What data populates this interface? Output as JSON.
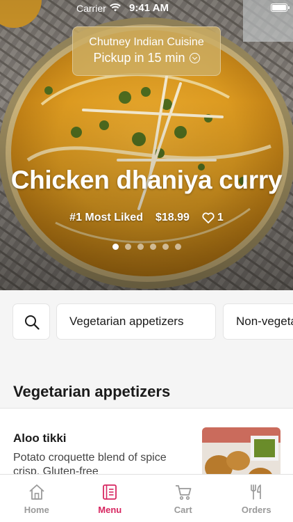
{
  "status_bar": {
    "carrier": "Carrier",
    "time": "9:41 AM"
  },
  "restaurant": {
    "name": "Chutney Indian Cuisine",
    "pickup": "Pickup in 15 min"
  },
  "featured": {
    "title": "Chicken dhaniya curry",
    "badge": "#1 Most Liked",
    "price": "$18.99",
    "likes": "1",
    "carousel_total": 6,
    "carousel_active": 1
  },
  "categories": [
    "Vegetarian appetizers",
    "Non-vegetarian appetizers"
  ],
  "section": {
    "title": "Vegetarian appetizers",
    "items": [
      {
        "name": "Aloo tikki",
        "description": "Potato croquette blend of spice crisp. Gluten-free"
      }
    ]
  },
  "tabs": [
    {
      "label": "Home",
      "icon": "home-icon"
    },
    {
      "label": "Menu",
      "icon": "menu-icon"
    },
    {
      "label": "Cart",
      "icon": "cart-icon"
    },
    {
      "label": "Orders",
      "icon": "orders-icon"
    }
  ],
  "active_tab": "Menu",
  "colors": {
    "accent": "#d72660",
    "card_gold": "#cdaf64"
  }
}
